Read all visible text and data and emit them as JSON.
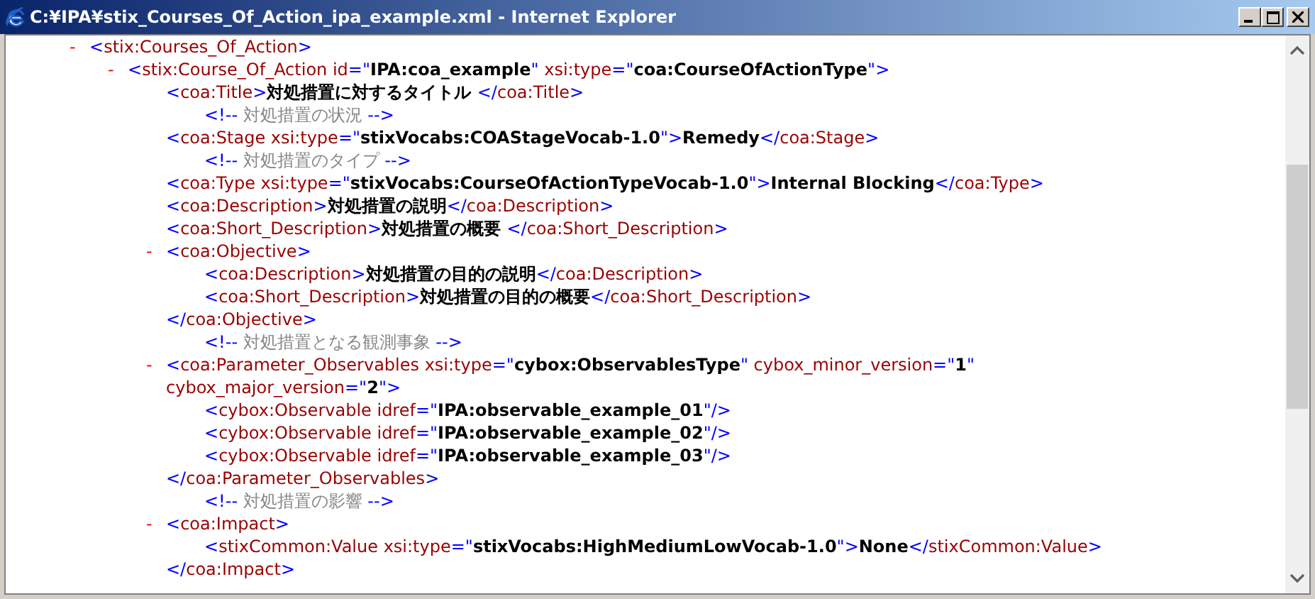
{
  "window": {
    "title": "C:¥IPA¥stix_Courses_Of_Action_ipa_example.xml - Internet Explorer"
  },
  "document": [
    {
      "kind": "element",
      "toggle": "-",
      "open": [
        [
          {
            "kind": "punct",
            "text": "<"
          },
          {
            "kind": "name",
            "text": "stix:Courses_Of_Action"
          },
          {
            "kind": "punct",
            "text": ">"
          }
        ]
      ],
      "children": [
        {
          "kind": "element",
          "toggle": "-",
          "open": [
            [
              {
                "kind": "punct",
                "text": "<"
              },
              {
                "kind": "name",
                "text": "stix:Course_Of_Action id"
              },
              {
                "kind": "punct",
                "text": "=\""
              },
              {
                "kind": "value",
                "text": "IPA:coa_example"
              },
              {
                "kind": "punct",
                "text": "\""
              },
              {
                "kind": "name",
                "text": " xsi:type"
              },
              {
                "kind": "punct",
                "text": "=\""
              },
              {
                "kind": "value",
                "text": "coa:CourseOfActionType"
              },
              {
                "kind": "punct",
                "text": "\">"
              }
            ]
          ],
          "children": [
            {
              "kind": "leaf",
              "line": [
                {
                  "kind": "punct",
                  "text": "<"
                },
                {
                  "kind": "name",
                  "text": "coa:Title"
                },
                {
                  "kind": "punct",
                  "text": ">"
                },
                {
                  "kind": "value",
                  "text": "対処措置に対するタイトル "
                },
                {
                  "kind": "punct",
                  "text": "</"
                },
                {
                  "kind": "name",
                  "text": "coa:Title"
                },
                {
                  "kind": "punct",
                  "text": ">"
                }
              ]
            },
            {
              "kind": "comment",
              "line": [
                {
                  "kind": "punct",
                  "text": "<!--"
                },
                {
                  "kind": "comment",
                  "text": " 対処措置の状況 "
                },
                {
                  "kind": "punct",
                  "text": "-->"
                }
              ]
            },
            {
              "kind": "leaf",
              "line": [
                {
                  "kind": "punct",
                  "text": "<"
                },
                {
                  "kind": "name",
                  "text": "coa:Stage xsi:type"
                },
                {
                  "kind": "punct",
                  "text": "=\""
                },
                {
                  "kind": "value",
                  "text": "stixVocabs:COAStageVocab-1.0"
                },
                {
                  "kind": "punct",
                  "text": "\">"
                },
                {
                  "kind": "value",
                  "text": "Remedy"
                },
                {
                  "kind": "punct",
                  "text": "</"
                },
                {
                  "kind": "name",
                  "text": "coa:Stage"
                },
                {
                  "kind": "punct",
                  "text": ">"
                }
              ]
            },
            {
              "kind": "comment",
              "line": [
                {
                  "kind": "punct",
                  "text": "<!--"
                },
                {
                  "kind": "comment",
                  "text": " 対処措置のタイプ "
                },
                {
                  "kind": "punct",
                  "text": "-->"
                }
              ]
            },
            {
              "kind": "leaf",
              "line": [
                {
                  "kind": "punct",
                  "text": "<"
                },
                {
                  "kind": "name",
                  "text": "coa:Type xsi:type"
                },
                {
                  "kind": "punct",
                  "text": "=\""
                },
                {
                  "kind": "value",
                  "text": "stixVocabs:CourseOfActionTypeVocab-1.0"
                },
                {
                  "kind": "punct",
                  "text": "\">"
                },
                {
                  "kind": "value",
                  "text": "Internal Blocking"
                },
                {
                  "kind": "punct",
                  "text": "</"
                },
                {
                  "kind": "name",
                  "text": "coa:Type"
                },
                {
                  "kind": "punct",
                  "text": ">"
                }
              ]
            },
            {
              "kind": "leaf",
              "line": [
                {
                  "kind": "punct",
                  "text": "<"
                },
                {
                  "kind": "name",
                  "text": "coa:Description"
                },
                {
                  "kind": "punct",
                  "text": ">"
                },
                {
                  "kind": "value",
                  "text": "対処措置の説明"
                },
                {
                  "kind": "punct",
                  "text": "</"
                },
                {
                  "kind": "name",
                  "text": "coa:Description"
                },
                {
                  "kind": "punct",
                  "text": ">"
                }
              ]
            },
            {
              "kind": "leaf",
              "line": [
                {
                  "kind": "punct",
                  "text": "<"
                },
                {
                  "kind": "name",
                  "text": "coa:Short_Description"
                },
                {
                  "kind": "punct",
                  "text": ">"
                },
                {
                  "kind": "value",
                  "text": "対処措置の概要 "
                },
                {
                  "kind": "punct",
                  "text": "</"
                },
                {
                  "kind": "name",
                  "text": "coa:Short_Description"
                },
                {
                  "kind": "punct",
                  "text": ">"
                }
              ]
            },
            {
              "kind": "element",
              "toggle": "-",
              "open": [
                [
                  {
                    "kind": "punct",
                    "text": "<"
                  },
                  {
                    "kind": "name",
                    "text": "coa:Objective"
                  },
                  {
                    "kind": "punct",
                    "text": ">"
                  }
                ]
              ],
              "children": [
                {
                  "kind": "leaf",
                  "line": [
                    {
                      "kind": "punct",
                      "text": "<"
                    },
                    {
                      "kind": "name",
                      "text": "coa:Description"
                    },
                    {
                      "kind": "punct",
                      "text": ">"
                    },
                    {
                      "kind": "value",
                      "text": "対処措置の目的の説明"
                    },
                    {
                      "kind": "punct",
                      "text": "</"
                    },
                    {
                      "kind": "name",
                      "text": "coa:Description"
                    },
                    {
                      "kind": "punct",
                      "text": ">"
                    }
                  ]
                },
                {
                  "kind": "leaf",
                  "line": [
                    {
                      "kind": "punct",
                      "text": "<"
                    },
                    {
                      "kind": "name",
                      "text": "coa:Short_Description"
                    },
                    {
                      "kind": "punct",
                      "text": ">"
                    },
                    {
                      "kind": "value",
                      "text": "対処措置の目的の概要"
                    },
                    {
                      "kind": "punct",
                      "text": "</"
                    },
                    {
                      "kind": "name",
                      "text": "coa:Short_Description"
                    },
                    {
                      "kind": "punct",
                      "text": ">"
                    }
                  ]
                }
              ],
              "close": [
                {
                  "kind": "punct",
                  "text": "</"
                },
                {
                  "kind": "name",
                  "text": "coa:Objective"
                },
                {
                  "kind": "punct",
                  "text": ">"
                }
              ]
            },
            {
              "kind": "comment",
              "line": [
                {
                  "kind": "punct",
                  "text": "<!--"
                },
                {
                  "kind": "comment",
                  "text": " 対処措置となる観測事象 "
                },
                {
                  "kind": "punct",
                  "text": "-->"
                }
              ]
            },
            {
              "kind": "element",
              "toggle": "-",
              "open": [
                [
                  {
                    "kind": "punct",
                    "text": "<"
                  },
                  {
                    "kind": "name",
                    "text": "coa:Parameter_Observables xsi:type"
                  },
                  {
                    "kind": "punct",
                    "text": "=\""
                  },
                  {
                    "kind": "value",
                    "text": "cybox:ObservablesType"
                  },
                  {
                    "kind": "punct",
                    "text": "\""
                  },
                  {
                    "kind": "name",
                    "text": " cybox_minor_version"
                  },
                  {
                    "kind": "punct",
                    "text": "=\""
                  },
                  {
                    "kind": "value",
                    "text": "1"
                  },
                  {
                    "kind": "punct",
                    "text": "\""
                  }
                ],
                [
                  {
                    "kind": "name",
                    "text": "cybox_major_version"
                  },
                  {
                    "kind": "punct",
                    "text": "=\""
                  },
                  {
                    "kind": "value",
                    "text": "2"
                  },
                  {
                    "kind": "punct",
                    "text": "\">"
                  }
                ]
              ],
              "children": [
                {
                  "kind": "leaf",
                  "line": [
                    {
                      "kind": "punct",
                      "text": "<"
                    },
                    {
                      "kind": "name",
                      "text": "cybox:Observable idref"
                    },
                    {
                      "kind": "punct",
                      "text": "=\""
                    },
                    {
                      "kind": "value",
                      "text": "IPA:observable_example_01"
                    },
                    {
                      "kind": "punct",
                      "text": "\"/>"
                    }
                  ]
                },
                {
                  "kind": "leaf",
                  "line": [
                    {
                      "kind": "punct",
                      "text": "<"
                    },
                    {
                      "kind": "name",
                      "text": "cybox:Observable idref"
                    },
                    {
                      "kind": "punct",
                      "text": "=\""
                    },
                    {
                      "kind": "value",
                      "text": "IPA:observable_example_02"
                    },
                    {
                      "kind": "punct",
                      "text": "\"/>"
                    }
                  ]
                },
                {
                  "kind": "leaf",
                  "line": [
                    {
                      "kind": "punct",
                      "text": "<"
                    },
                    {
                      "kind": "name",
                      "text": "cybox:Observable idref"
                    },
                    {
                      "kind": "punct",
                      "text": "=\""
                    },
                    {
                      "kind": "value",
                      "text": "IPA:observable_example_03"
                    },
                    {
                      "kind": "punct",
                      "text": "\"/>"
                    }
                  ]
                }
              ],
              "close": [
                {
                  "kind": "punct",
                  "text": "</"
                },
                {
                  "kind": "name",
                  "text": "coa:Parameter_Observables"
                },
                {
                  "kind": "punct",
                  "text": ">"
                }
              ]
            },
            {
              "kind": "comment",
              "line": [
                {
                  "kind": "punct",
                  "text": "<!--"
                },
                {
                  "kind": "comment",
                  "text": " 対処措置の影響 "
                },
                {
                  "kind": "punct",
                  "text": "-->"
                }
              ]
            },
            {
              "kind": "element",
              "toggle": "-",
              "open": [
                [
                  {
                    "kind": "punct",
                    "text": "<"
                  },
                  {
                    "kind": "name",
                    "text": "coa:Impact"
                  },
                  {
                    "kind": "punct",
                    "text": ">"
                  }
                ]
              ],
              "children": [
                {
                  "kind": "leaf",
                  "line": [
                    {
                      "kind": "punct",
                      "text": "<"
                    },
                    {
                      "kind": "name",
                      "text": "stixCommon:Value xsi:type"
                    },
                    {
                      "kind": "punct",
                      "text": "=\""
                    },
                    {
                      "kind": "value",
                      "text": "stixVocabs:HighMediumLowVocab-1.0"
                    },
                    {
                      "kind": "punct",
                      "text": "\">"
                    },
                    {
                      "kind": "value",
                      "text": "None"
                    },
                    {
                      "kind": "punct",
                      "text": "</"
                    },
                    {
                      "kind": "name",
                      "text": "stixCommon:Value"
                    },
                    {
                      "kind": "punct",
                      "text": ">"
                    }
                  ]
                }
              ],
              "close": [
                {
                  "kind": "punct",
                  "text": "</"
                },
                {
                  "kind": "name",
                  "text": "coa:Impact"
                },
                {
                  "kind": "punct",
                  "text": ">"
                }
              ]
            }
          ]
        }
      ]
    }
  ]
}
